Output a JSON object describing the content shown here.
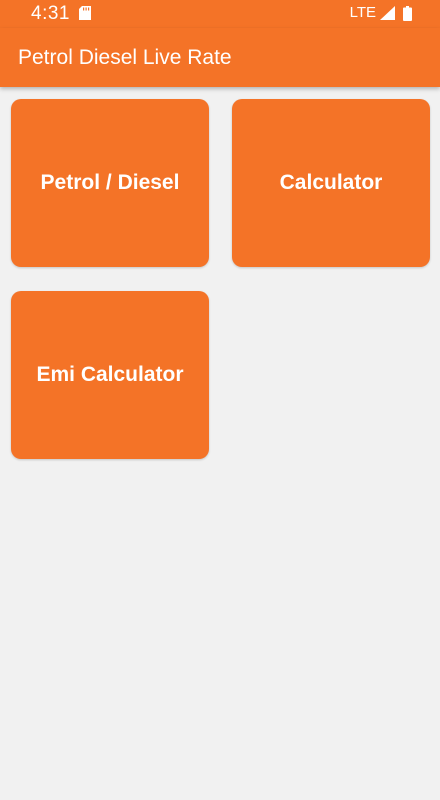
{
  "status_bar": {
    "time": "4:31",
    "network": "LTE",
    "icons": [
      "sd-card-icon",
      "signal-icon",
      "battery-icon"
    ]
  },
  "app_bar": {
    "title": "Petrol Diesel Live Rate"
  },
  "tiles": [
    {
      "label": "Petrol / Diesel"
    },
    {
      "label": "Calculator"
    },
    {
      "label": "Emi Calculator"
    }
  ],
  "colors": {
    "primary": "#f47327",
    "background": "#f1f1f1",
    "text_on_primary": "#ffffff"
  }
}
